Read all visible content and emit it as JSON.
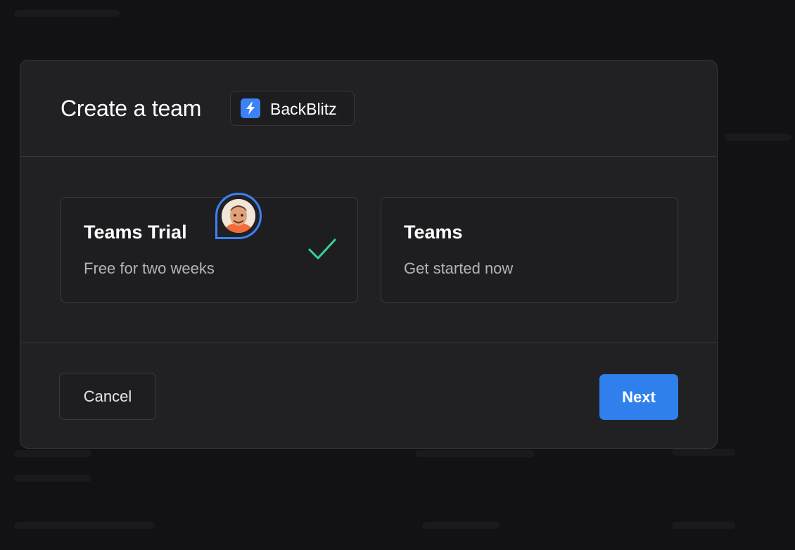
{
  "modal": {
    "title": "Create a team",
    "workspace": {
      "name": "BackBlitz",
      "icon": "lightning-icon",
      "icon_color": "#3b82f6"
    }
  },
  "plans": [
    {
      "name": "Teams Trial",
      "subtitle": "Free for two weeks",
      "selected": true,
      "check_icon": "checkmark-icon",
      "check_color": "#34d399"
    },
    {
      "name": "Teams",
      "subtitle": "Get started now",
      "selected": false
    }
  ],
  "cursor": {
    "icon": "user-avatar-pin-icon",
    "color": "#3b82f6"
  },
  "footer": {
    "cancel_label": "Cancel",
    "next_label": "Next",
    "accent": "#2f80ed"
  }
}
